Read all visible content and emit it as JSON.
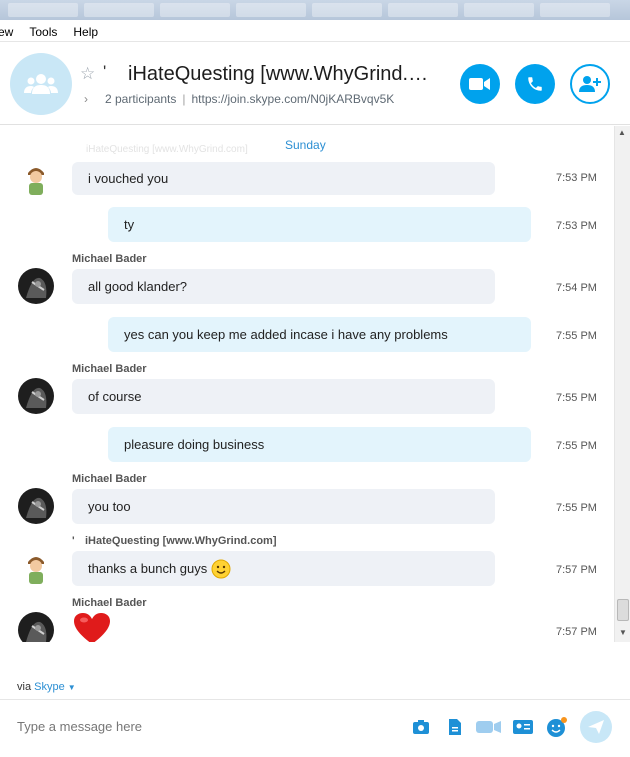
{
  "menu": {
    "items": [
      "ew",
      "Tools",
      "Help"
    ]
  },
  "header": {
    "title_tick": "'",
    "title": "iHateQuesting [www.WhyGrind.…",
    "participants": "2 participants",
    "separator": "|",
    "link": "https://join.skype.com/N0jKARBvqv5K"
  },
  "conversation": {
    "day": "Sunday",
    "ghost_name": "iHateQuesting [www.WhyGrind.com]",
    "messages": [
      {
        "text": "i vouched you",
        "time": "7:53 PM"
      },
      {
        "text": "ty",
        "time": "7:53 PM"
      },
      {
        "sender": "Michael Bader",
        "text": "all good klander?",
        "time": "7:54 PM"
      },
      {
        "text": "yes can you keep me added incase i have any problems",
        "time": "7:55 PM"
      },
      {
        "sender": "Michael Bader",
        "text": "of course",
        "time": "7:55 PM"
      },
      {
        "text": "pleasure doing business",
        "time": "7:55 PM"
      },
      {
        "sender": "Michael Bader",
        "text": "you too",
        "time": "7:55 PM"
      },
      {
        "sender": "iHateQuesting [www.WhyGrind.com]",
        "sender_tick": "'",
        "text": "thanks a bunch guys",
        "time": "7:57 PM"
      },
      {
        "sender": "Michael Bader",
        "time": "7:57 PM"
      }
    ]
  },
  "footer": {
    "via_label": "via",
    "via_link": "Skype",
    "compose_placeholder": "Type a message here"
  },
  "colors": {
    "accent": "#00a2ed",
    "incoming_bubble": "#eef1f6",
    "outgoing_bubble": "#e3f4fc",
    "heart": "#e01b1b"
  },
  "icons": {
    "group": "people-icon",
    "favorite": "star-icon",
    "video": "video-camera-icon",
    "call": "phone-icon",
    "add": "add-person-icon",
    "smile": "smiley-emoji",
    "heart": "heart-emoji",
    "send": "send-icon"
  }
}
